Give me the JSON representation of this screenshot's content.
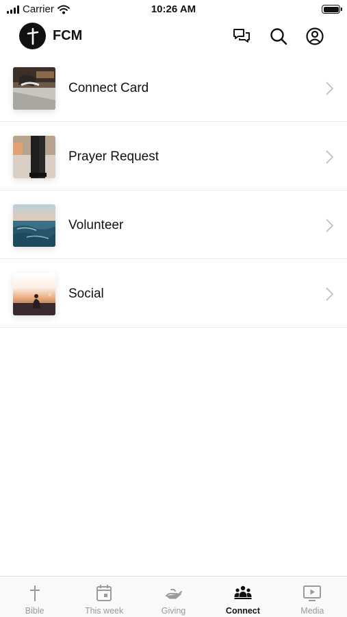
{
  "status_bar": {
    "carrier": "Carrier",
    "time": "10:26 AM"
  },
  "header": {
    "brand": "FCM"
  },
  "list": {
    "items": [
      {
        "label": "Connect Card"
      },
      {
        "label": "Prayer Request"
      },
      {
        "label": "Volunteer"
      },
      {
        "label": "Social"
      }
    ]
  },
  "tabbar": {
    "tabs": [
      {
        "label": "Bible",
        "icon": "cross-icon"
      },
      {
        "label": "This week",
        "icon": "calendar-icon"
      },
      {
        "label": "Giving",
        "icon": "giving-hand-icon"
      },
      {
        "label": "Connect",
        "icon": "people-icon"
      },
      {
        "label": "Media",
        "icon": "play-screen-icon"
      }
    ],
    "active_tab": "Connect"
  },
  "colors": {
    "active": "#111111",
    "inactive": "#9a9a9a",
    "divider": "#ececec"
  }
}
